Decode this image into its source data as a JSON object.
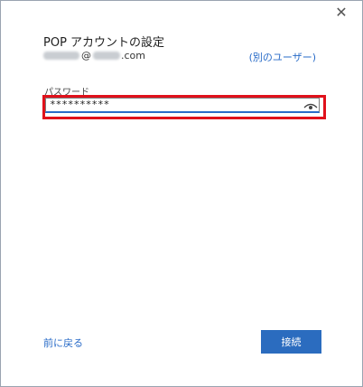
{
  "dialog": {
    "title": "POP アカウントの設定",
    "email_at": "@",
    "email_tld": ".com",
    "other_user_link": "(別のユーザー)",
    "close_glyph": "✕"
  },
  "password": {
    "label": "パスワード",
    "value": "**********"
  },
  "footer": {
    "back_link": "前に戻る",
    "connect_button": "接続"
  },
  "colors": {
    "accent": "#2b6cbf",
    "highlight": "#e0111b",
    "link": "#2a6cc8"
  },
  "icons": {
    "close": "close-icon",
    "reveal": "eye-icon"
  }
}
